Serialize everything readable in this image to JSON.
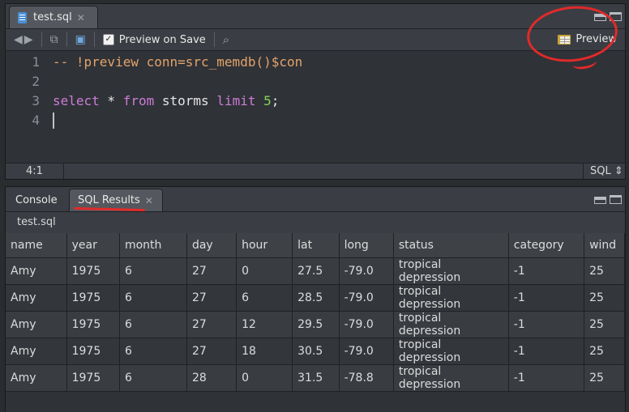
{
  "editor": {
    "tab_label": "test.sql",
    "toolbar": {
      "preview_on_save_label": "Preview on Save",
      "preview_on_save_checked": true,
      "preview_label": "Preview"
    },
    "lines": [
      {
        "num": "1",
        "text": "-- !preview conn=src_memdb()$con"
      },
      {
        "num": "2",
        "text": ""
      },
      {
        "num": "3",
        "segments": [
          "select",
          " * ",
          "from",
          " storms ",
          "limit",
          " ",
          "5",
          ";"
        ]
      },
      {
        "num": "4",
        "text": ""
      }
    ],
    "status_position": "4:1",
    "status_language": "SQL ⇕"
  },
  "results": {
    "tabs": [
      {
        "label": "Console"
      },
      {
        "label": "SQL Results"
      }
    ],
    "subtitle": "test.sql",
    "columns": [
      "name",
      "year",
      "month",
      "day",
      "hour",
      "lat",
      "long",
      "status",
      "category",
      "wind"
    ],
    "rows": [
      [
        "Amy",
        "1975",
        "6",
        "27",
        "0",
        "27.5",
        "-79.0",
        "tropical depression",
        "-1",
        "25"
      ],
      [
        "Amy",
        "1975",
        "6",
        "27",
        "6",
        "28.5",
        "-79.0",
        "tropical depression",
        "-1",
        "25"
      ],
      [
        "Amy",
        "1975",
        "6",
        "27",
        "12",
        "29.5",
        "-79.0",
        "tropical depression",
        "-1",
        "25"
      ],
      [
        "Amy",
        "1975",
        "6",
        "27",
        "18",
        "30.5",
        "-79.0",
        "tropical depression",
        "-1",
        "25"
      ],
      [
        "Amy",
        "1975",
        "6",
        "28",
        "0",
        "31.5",
        "-78.8",
        "tropical depression",
        "-1",
        "25"
      ]
    ]
  },
  "colors": {
    "annotation": "#e12a2a",
    "keyword": "#cc7cd6",
    "comment": "#e2a36a",
    "number": "#86d35a"
  }
}
